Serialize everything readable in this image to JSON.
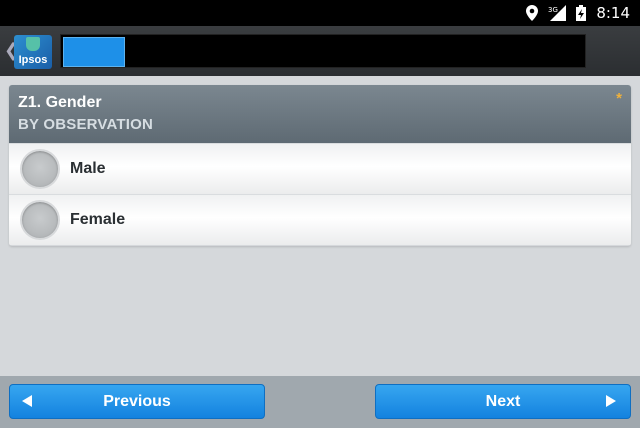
{
  "status_bar": {
    "network_label": "3G",
    "time": "8:14"
  },
  "action_bar": {
    "logo_text": "Ipsos"
  },
  "question": {
    "title": "Z1. Gender",
    "subtitle": "BY OBSERVATION",
    "required_marker": "*",
    "options": [
      {
        "label": "Male"
      },
      {
        "label": "Female"
      }
    ]
  },
  "navigation": {
    "previous_label": "Previous",
    "next_label": "Next"
  },
  "colors": {
    "accent": "#1e90e8",
    "required": "#f0b13a"
  }
}
